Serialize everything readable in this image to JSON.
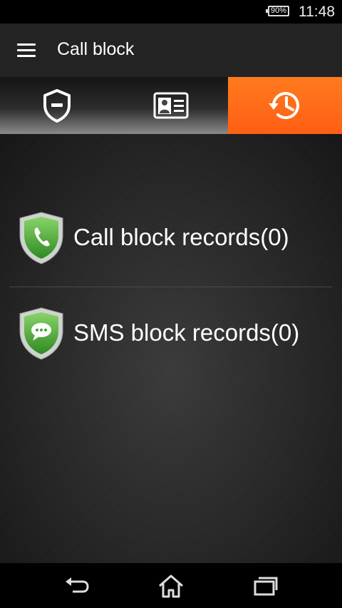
{
  "status_bar": {
    "battery": "90%",
    "time": "11:48"
  },
  "app_bar": {
    "title": "Call block",
    "menu_icon": "hamburger-menu-icon"
  },
  "tabs": [
    {
      "icon": "shield-minus-icon",
      "active": false
    },
    {
      "icon": "contact-card-icon",
      "active": false
    },
    {
      "icon": "history-clock-icon",
      "active": true
    }
  ],
  "records": [
    {
      "label": "Call block records(0)",
      "icon": "phone-shield-icon"
    },
    {
      "label": "SMS block records(0)",
      "icon": "message-shield-icon"
    }
  ],
  "nav_bar": {
    "back_icon": "back-icon",
    "home_icon": "home-icon",
    "recents_icon": "recents-icon"
  },
  "colors": {
    "accent": "#ff6a1a",
    "shield_green": "#3fa535",
    "app_bar": "#232323"
  }
}
